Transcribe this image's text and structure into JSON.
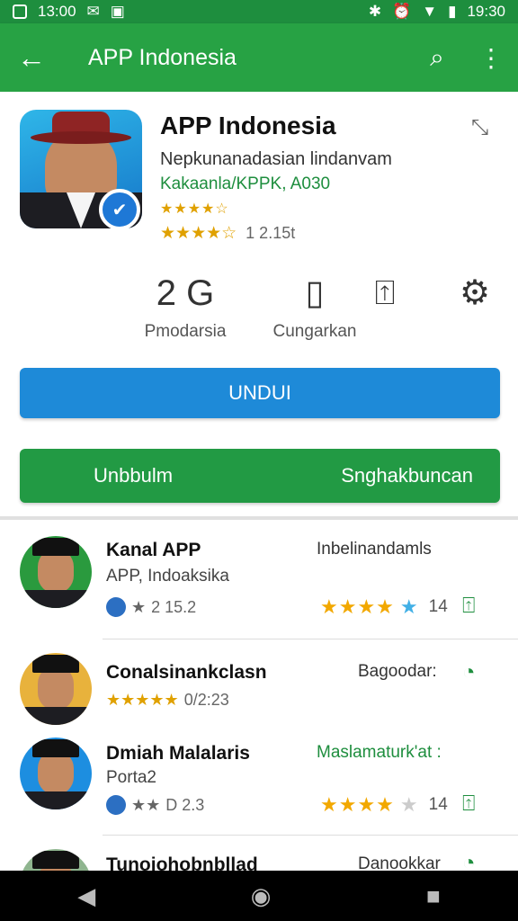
{
  "status_bar": {
    "time_left": "13:00",
    "time_right": "19:30"
  },
  "app_bar": {
    "title": "APP Indonesia",
    "back_icon": "arrow-left-icon",
    "search_icon": "search-icon",
    "menu_icon": "more-vert-icon"
  },
  "header": {
    "app_name": "APP Indonesia",
    "developer": "Nepkunanadasian lindanvam",
    "category": "Kakaanla/KPPK, A030",
    "rating_count": "1 2.15t",
    "stats": [
      {
        "value": "2 G",
        "label": "Pmodarsia"
      },
      {
        "icon": "document-icon",
        "label": "Cungarkan"
      },
      {
        "icon": "share-icon",
        "label": ""
      },
      {
        "icon": "tools-icon",
        "label": ""
      }
    ],
    "primary_button": "UNDUI",
    "secondary_left": "Unbbulm",
    "secondary_right": "Snghakbuncan"
  },
  "list": [
    {
      "name": "Kanal APP",
      "sub": "APP, Indoaksika",
      "right": "Inbelinandamls",
      "meta": "2 15.2",
      "count": "14",
      "action_icon": "share-icon"
    },
    {
      "name": "Conalsinankclasn",
      "sub": "",
      "right": "Bagoodar:",
      "meta": "0/2:23",
      "count": "",
      "action_icon": "chat-icon"
    },
    {
      "name": "Dmiah Malalaris",
      "sub": "Porta2",
      "right": "Maslamaturk'at :",
      "meta": "D 2.3",
      "count": "14",
      "action_icon": "share-icon"
    },
    {
      "name": "Tunoiohobnbllad",
      "sub": "",
      "right": "Danookkar",
      "meta": "",
      "count": "",
      "action_icon": "chat-icon"
    }
  ],
  "colors": {
    "app_bar": "#27a244",
    "primary": "#1e8ad8",
    "secondary": "#229a44",
    "star": "#f2a800"
  }
}
